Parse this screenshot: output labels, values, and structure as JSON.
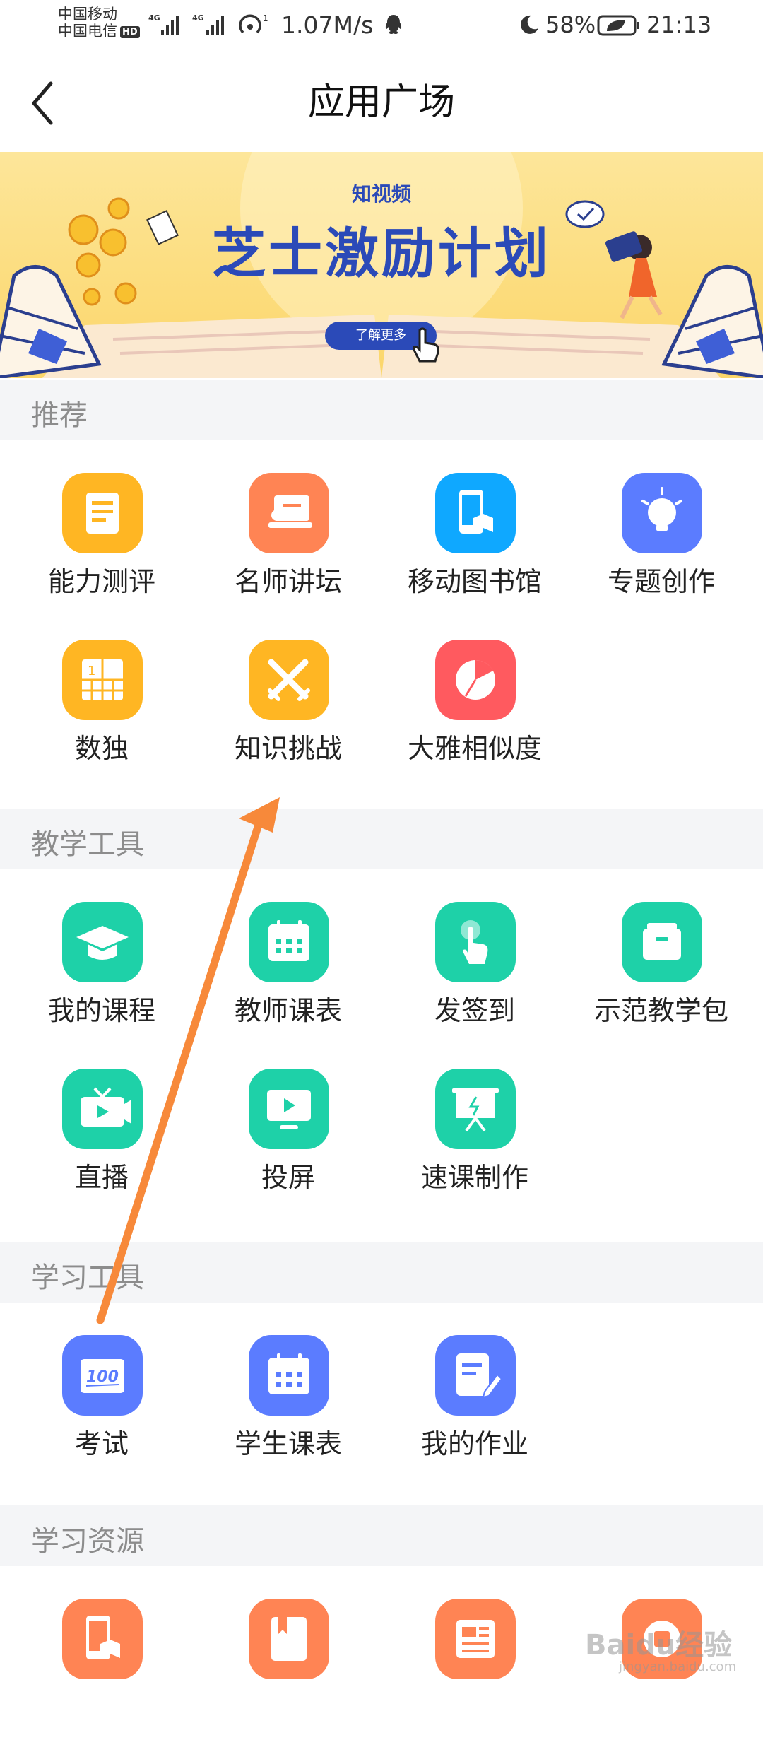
{
  "status_bar": {
    "carrier_1": "中国移动",
    "carrier_2": "中国电信",
    "hd_badge": "HD",
    "net_1": "4G",
    "net_2": "4G",
    "hotspot_badge": "1",
    "speed": "1.07M/s",
    "battery": "58%",
    "time": "21:13"
  },
  "header": {
    "title": "应用广场"
  },
  "banner": {
    "brand": "知视频",
    "headline": "芝士激励计划",
    "button": "了解更多"
  },
  "sections": [
    {
      "title": "推荐",
      "items": [
        {
          "label": "能力测评",
          "icon": "report-icon",
          "color": "#ffb623"
        },
        {
          "label": "名师讲坛",
          "icon": "lecture-icon",
          "color": "#ff8454"
        },
        {
          "label": "移动图书馆",
          "icon": "mobile-library-icon",
          "color": "#0fa8ff"
        },
        {
          "label": "专题创作",
          "icon": "lightbulb-icon",
          "color": "#5b7cff"
        },
        {
          "label": "数独",
          "icon": "sudoku-icon",
          "color": "#ffb623"
        },
        {
          "label": "知识挑战",
          "icon": "crossed-swords-icon",
          "color": "#ffb623"
        },
        {
          "label": "大雅相似度",
          "icon": "pie-chart-icon",
          "color": "#ff5a5f"
        }
      ]
    },
    {
      "title": "教学工具",
      "items": [
        {
          "label": "我的课程",
          "icon": "graduation-cap-icon",
          "color": "#1ed1a8"
        },
        {
          "label": "教师课表",
          "icon": "calendar-icon",
          "color": "#1ed1a8"
        },
        {
          "label": "发签到",
          "icon": "tap-finger-icon",
          "color": "#1ed1a8"
        },
        {
          "label": "示范教学包",
          "icon": "package-icon",
          "color": "#1ed1a8"
        },
        {
          "label": "直播",
          "icon": "live-tv-icon",
          "color": "#1ed1a8"
        },
        {
          "label": "投屏",
          "icon": "screen-cast-icon",
          "color": "#1ed1a8"
        },
        {
          "label": "速课制作",
          "icon": "presentation-icon",
          "color": "#1ed1a8"
        }
      ]
    },
    {
      "title": "学习工具",
      "items": [
        {
          "label": "考试",
          "icon": "exam-100-icon",
          "color": "#5b7cff"
        },
        {
          "label": "学生课表",
          "icon": "calendar-icon",
          "color": "#5b7cff"
        },
        {
          "label": "我的作业",
          "icon": "homework-pencil-icon",
          "color": "#5b7cff"
        }
      ]
    },
    {
      "title": "学习资源",
      "items": [
        {
          "label": "",
          "icon": "mobile-library-icon",
          "color": "#ff8454"
        },
        {
          "label": "",
          "icon": "book-icon",
          "color": "#ff8454"
        },
        {
          "label": "",
          "icon": "document-icon",
          "color": "#ff8454"
        },
        {
          "label": "",
          "icon": "resource-icon",
          "color": "#ff8454"
        }
      ]
    }
  ],
  "watermark": {
    "text": "Baidu经验",
    "sub": "jingyan.baidu.com"
  }
}
